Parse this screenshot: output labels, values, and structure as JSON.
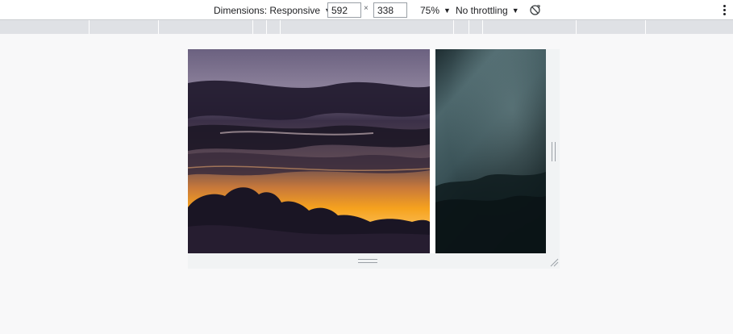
{
  "toolbar": {
    "dimensions_label": "Dimensions: Responsive",
    "width_value": "592",
    "times_symbol": "×",
    "height_value": "338",
    "zoom_label": "75%",
    "throttling_label": "No throttling",
    "caret": "▼",
    "rotate_icon": "rotate-icon",
    "more_icon": "more-options-icon"
  },
  "media_queries": {
    "count": 14
  },
  "device": {
    "images": [
      {
        "name": "sunset-clouds-image",
        "colors": [
          "#6b6180",
          "#2a2338",
          "#f29b1f",
          "#1a1524"
        ]
      },
      {
        "name": "teal-fog-image",
        "colors": [
          "#4c666b",
          "#243538",
          "#0f1c1e"
        ]
      }
    ]
  }
}
